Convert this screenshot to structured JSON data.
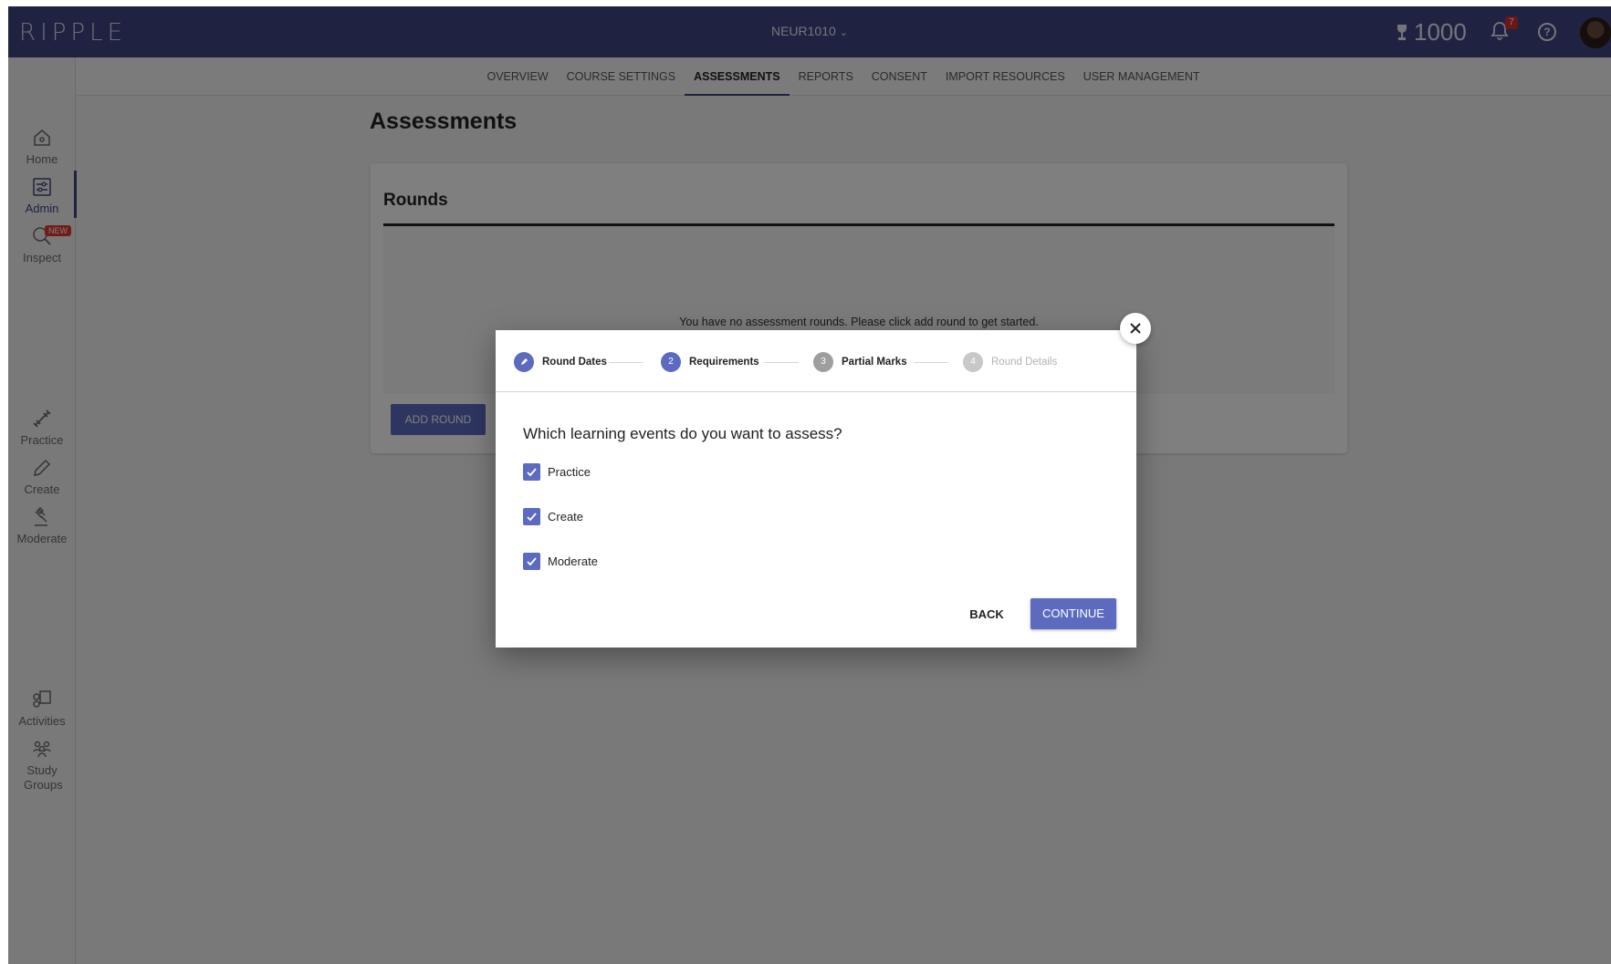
{
  "topbar": {
    "logo": "RIPPLE",
    "course": "NEUR1010",
    "course_chevron": "chevron-down-icon",
    "points": "1000",
    "notification_count": "7",
    "help": "?"
  },
  "sidebar": {
    "items": [
      {
        "label": "Home",
        "icon": "home-icon"
      },
      {
        "label": "Admin",
        "icon": "admin-sliders-icon"
      },
      {
        "label": "Inspect",
        "icon": "magnifier-icon",
        "badge": "NEW"
      },
      {
        "label": "Practice",
        "icon": "dumbbell-icon"
      },
      {
        "label": "Create",
        "icon": "pencil-icon"
      },
      {
        "label": "Moderate",
        "icon": "gavel-icon"
      },
      {
        "label": "Activities",
        "icon": "activities-icon"
      },
      {
        "label": "Study Groups",
        "icon": "people-group-icon"
      }
    ]
  },
  "tabs": [
    "OVERVIEW",
    "COURSE SETTINGS",
    "ASSESSMENTS",
    "REPORTS",
    "CONSENT",
    "IMPORT RESOURCES",
    "USER MANAGEMENT"
  ],
  "active_tab": "ASSESSMENTS",
  "main": {
    "title": "Assessments",
    "card_title": "Rounds",
    "empty_text": "You have no assessment rounds. Please click add round to get started.",
    "add_round": "ADD ROUND"
  },
  "dialog": {
    "steps": [
      {
        "number": "✓",
        "label": "Round Dates",
        "state": "done"
      },
      {
        "number": "2",
        "label": "Requirements",
        "state": "current"
      },
      {
        "number": "3",
        "label": "Partial Marks",
        "state": "todo"
      },
      {
        "number": "4",
        "label": "Round Details",
        "state": "disabled"
      }
    ],
    "question": "Which learning events do you want to assess?",
    "options": [
      {
        "label": "Practice",
        "checked": true
      },
      {
        "label": "Create",
        "checked": true
      },
      {
        "label": "Moderate",
        "checked": true
      }
    ],
    "back": "BACK",
    "continue": "CONTINUE"
  },
  "colors": {
    "header": "#3e4782",
    "accent": "#5c6bc0",
    "badge_red": "#e53935"
  }
}
